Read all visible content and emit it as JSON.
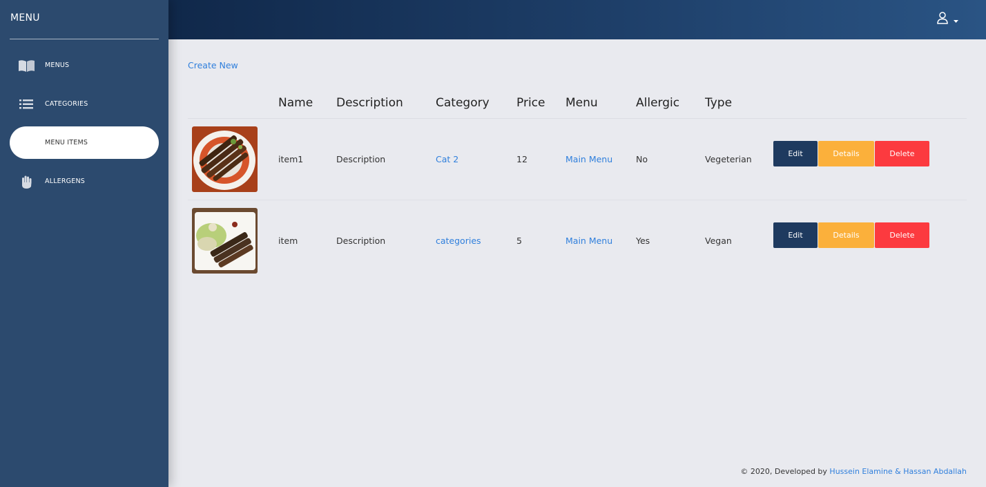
{
  "sidebar": {
    "brand": "MENU",
    "items": [
      {
        "label": "MENUS",
        "icon": "book-icon"
      },
      {
        "label": "CATEGORIES",
        "icon": "list-icon"
      },
      {
        "label": "MENU ITEMS",
        "icon": "none"
      },
      {
        "label": "ALLERGENS",
        "icon": "hand-icon"
      }
    ]
  },
  "topbar": {
    "user_icon": "user-icon",
    "caret_icon": "caret-down-icon"
  },
  "main": {
    "create_new": "Create New",
    "columns": [
      "Name",
      "Description",
      "Category",
      "Price",
      "Menu",
      "Allergic",
      "Type"
    ],
    "rows": [
      {
        "name": "item1",
        "description": "Description",
        "category": "Cat 2",
        "price": "12",
        "menu": "Main Menu",
        "allergic": "No",
        "type": "Vegeterian"
      },
      {
        "name": "item",
        "description": "Description",
        "category": "categories",
        "price": "5",
        "menu": "Main Menu",
        "allergic": "Yes",
        "type": "Vegan"
      }
    ],
    "actions": {
      "edit": "Edit",
      "details": "Details",
      "delete": "Delete"
    }
  },
  "footer": {
    "prefix": "© 2020, Developed by",
    "authors": "Hussein Elamine & Hassan Abdallah"
  },
  "colors": {
    "sidebar": "#2c4a6e",
    "topbar_start": "#10284a",
    "topbar_end": "#2a5484",
    "link": "#2f7fdc",
    "edit": "#1e3a5f",
    "details": "#fbb03b",
    "delete": "#fc3a3f"
  }
}
